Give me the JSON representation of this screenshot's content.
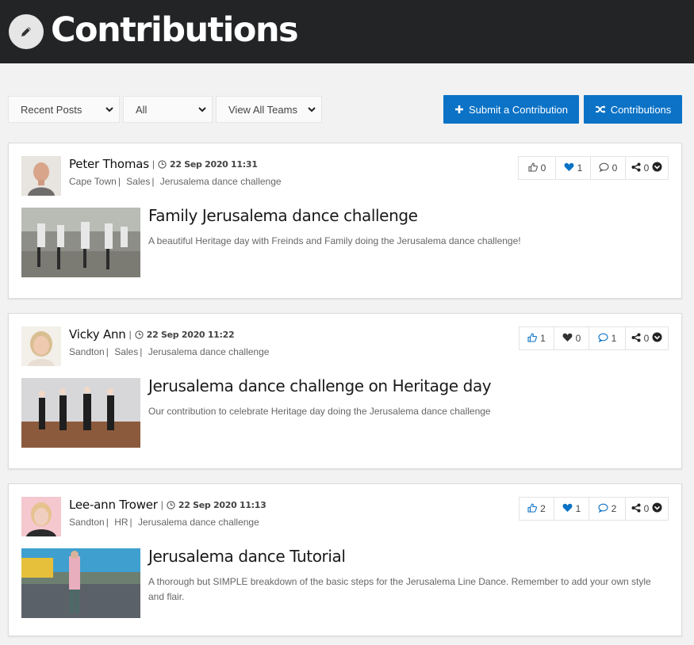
{
  "header": {
    "title": "Contributions"
  },
  "filters": {
    "sort": "Recent Posts",
    "category": "All",
    "teams": "View All Teams"
  },
  "buttons": {
    "submit": "Submit a Contribution",
    "contributions": "Contributions"
  },
  "colors": {
    "accent": "#0b72c6",
    "header_bg": "#222426"
  },
  "posts": [
    {
      "author": "Peter Thomas",
      "date": "22 Sep 2020 11:31",
      "location": "Cape Town",
      "team": "Sales",
      "tag": "Jerusalema dance challenge",
      "likes": "0",
      "hearts": "1",
      "comments": "0",
      "shares": "0",
      "title": "Family Jerusalema dance challenge",
      "description": "A beautiful Heritage day with Freinds and Family doing the Jerusalema dance challenge!"
    },
    {
      "author": "Vicky Ann",
      "date": "22 Sep 2020 11:22",
      "location": "Sandton",
      "team": "Sales",
      "tag": "Jerusalema dance challenge",
      "likes": "1",
      "hearts": "0",
      "comments": "1",
      "shares": "0",
      "title": "Jerusalema dance challenge on Heritage day",
      "description": "Our contribution to celebrate Heritage day doing the Jerusalema dance challenge"
    },
    {
      "author": "Lee-ann Trower",
      "date": "22 Sep 2020 11:13",
      "location": "Sandton",
      "team": "HR",
      "tag": "Jerusalema dance challenge",
      "likes": "2",
      "hearts": "1",
      "comments": "2",
      "shares": "0",
      "title": "Jerusalema dance Tutorial",
      "description": "A thorough but SIMPLE breakdown of the basic steps for the Jerusalema Line Dance. Remember to add your own style and flair."
    }
  ]
}
